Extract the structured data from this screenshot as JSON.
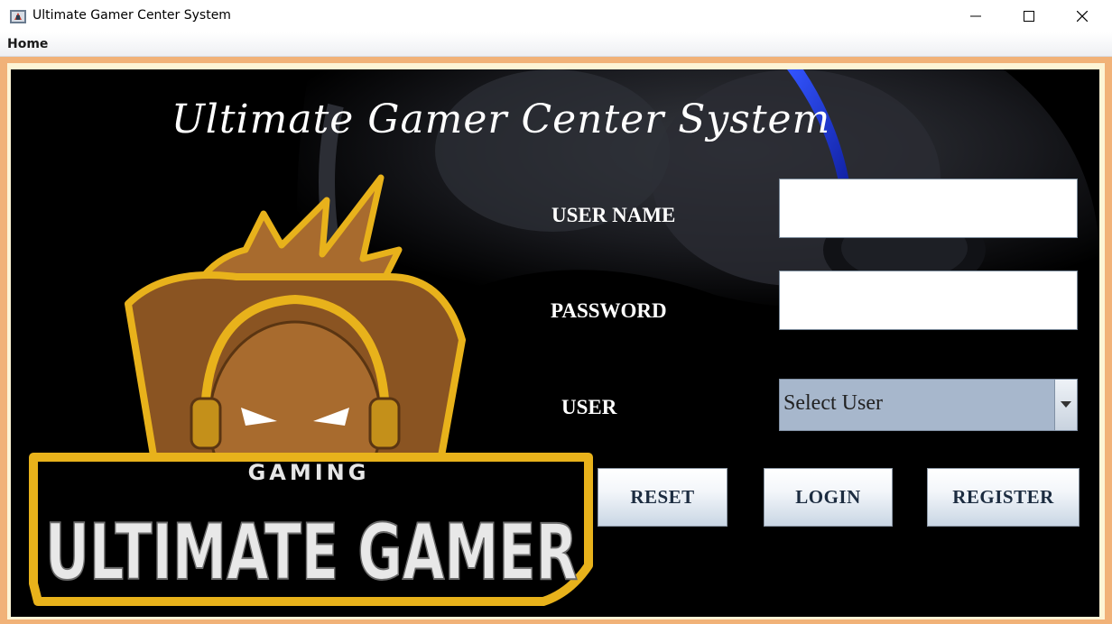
{
  "window": {
    "title": "Ultimate Gamer Center System",
    "icon": "java-app-icon",
    "controls": [
      "minimize-icon",
      "maximize-icon",
      "close-icon"
    ]
  },
  "menu": {
    "home_label": "Home"
  },
  "main": {
    "title": "Ultimate Gamer Center System",
    "username_label": "USER NAME",
    "username_value": "",
    "password_label": "PASSWORD",
    "password_value": "",
    "user_label": "USER",
    "user_select_value": "Select User",
    "reset_label": "RESET",
    "login_label": "LOGIN",
    "register_label": "REGISTER"
  },
  "logo": {
    "top_text": "GAMING",
    "bottom_text": "ULTIMATE GAMER"
  },
  "colors": {
    "frame": "#f1b278",
    "panel": "#000000",
    "logo_gold": "#e8b21b",
    "logo_brown": "#a86b2e",
    "button_text": "#1c2c40",
    "combo": "#a7b7cc"
  }
}
